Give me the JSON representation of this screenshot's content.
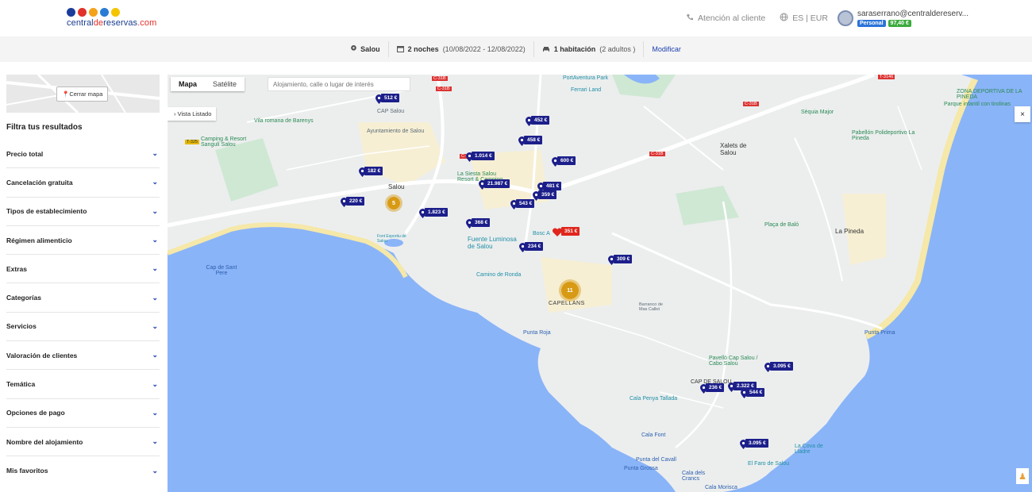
{
  "header": {
    "logo": {
      "part1": "central",
      "part2": "de",
      "part3": "reservas",
      "part4": ".com",
      "dot_colors": [
        "#1c3c9c",
        "#e0312a",
        "#f3a21a",
        "#2a7bd3",
        "#f5c400"
      ]
    },
    "support_label": "Atención al cliente",
    "lang_currency": "ES | EUR",
    "user_email": "saraserrano@centraldereserv...",
    "badge_personal": "Personal",
    "badge_points": "97,40 €"
  },
  "searchbar": {
    "location": "Salou",
    "nights": "2 noches",
    "dates": "(10/08/2022 - 12/08/2022)",
    "rooms": "1 habitación",
    "guests": "(2 adultos )",
    "modify": "Modificar"
  },
  "sidebar": {
    "close_map": "Cerrar mapa",
    "filters_title": "Filtra tus resultados",
    "filters": [
      "Precio total",
      "Cancelación gratuita",
      "Tipos de establecimiento",
      "Régimen alimenticio",
      "Extras",
      "Categorías",
      "Servicios",
      "Valoración de clientes",
      "Temática",
      "Opciones de pago",
      "Nombre del alojamiento",
      "Mis favoritos"
    ]
  },
  "map": {
    "tab_map": "Mapa",
    "tab_satellite": "Satélite",
    "search_placeholder": "Alojamiento, calle o lugar de interés",
    "list_view": "Vista Listado",
    "close": "×",
    "price_pins": [
      "512 €",
      "452 €",
      "458 €",
      "600 €",
      "182 €",
      "1.014 €",
      "21.987 €",
      "481 €",
      "359 €",
      "220 €",
      "543 €",
      "1.823 €",
      "368 €",
      "351 €",
      "234 €",
      "309 €",
      "3.095 €",
      "236 €",
      "2.322 €",
      "544 €",
      "3.095 €"
    ],
    "clusters": [
      "5",
      "11"
    ],
    "places": {
      "portaventura": "PortAventura Park",
      "ferrari": "Ferrari Land",
      "cap_salou_top": "CAP Salou",
      "ayuntamiento": "Ayuntamiento de Salou",
      "sequia": "Sèquia Major",
      "parque_infantil": "Parque infantil con tirolinas",
      "zona_deportiva": "ZONA DEPORTIVA DE LA PINEDA",
      "pabellon": "Pabellón Polideportivo La Pineda",
      "villa_romana": "Vila romana de Barenys",
      "camping": "Camping & Resort Sangulí Salou",
      "xalets": "Xalets de Salou",
      "salou": "Salou",
      "la_siesta": "La Siesta Salou Resort & Camping",
      "font_esportiu": "Font Esportiu de Salou",
      "fuente": "Fuente Luminosa de Salou",
      "bosc": "Bosc A",
      "placa_balo": "Plaça de Baló",
      "la_pineda": "La Pineda",
      "cap_sant_pere": "Cap de Sant Pere",
      "camino_ronda": "Camino de Ronda",
      "capellans": "CAPELLANS",
      "barranco": "Barranco de Mas Calbó",
      "punta_prima": "Punta Prima",
      "punta_roja": "Punta Roja",
      "pavello": "Pavelló Cap Salou / Cabo Salou",
      "cap_de_salou": "CAP DE SALOU",
      "cala_penya": "Cala Penya Tallada",
      "cala_font": "Cala Font",
      "punta_cavall": "Punta del Cavall",
      "punta_grossa": "Punta Grossa",
      "cala_crancs": "Cala dels Crancs",
      "cala_morisca": "Cala Morisca",
      "faro": "El Faro de Salou",
      "cova_lladre": "La Cova de Lladre"
    },
    "road_tags": [
      "C-31B",
      "T-3146",
      "T-325",
      "C-31B",
      "C-31B",
      "C-31B",
      "C-31B"
    ]
  }
}
